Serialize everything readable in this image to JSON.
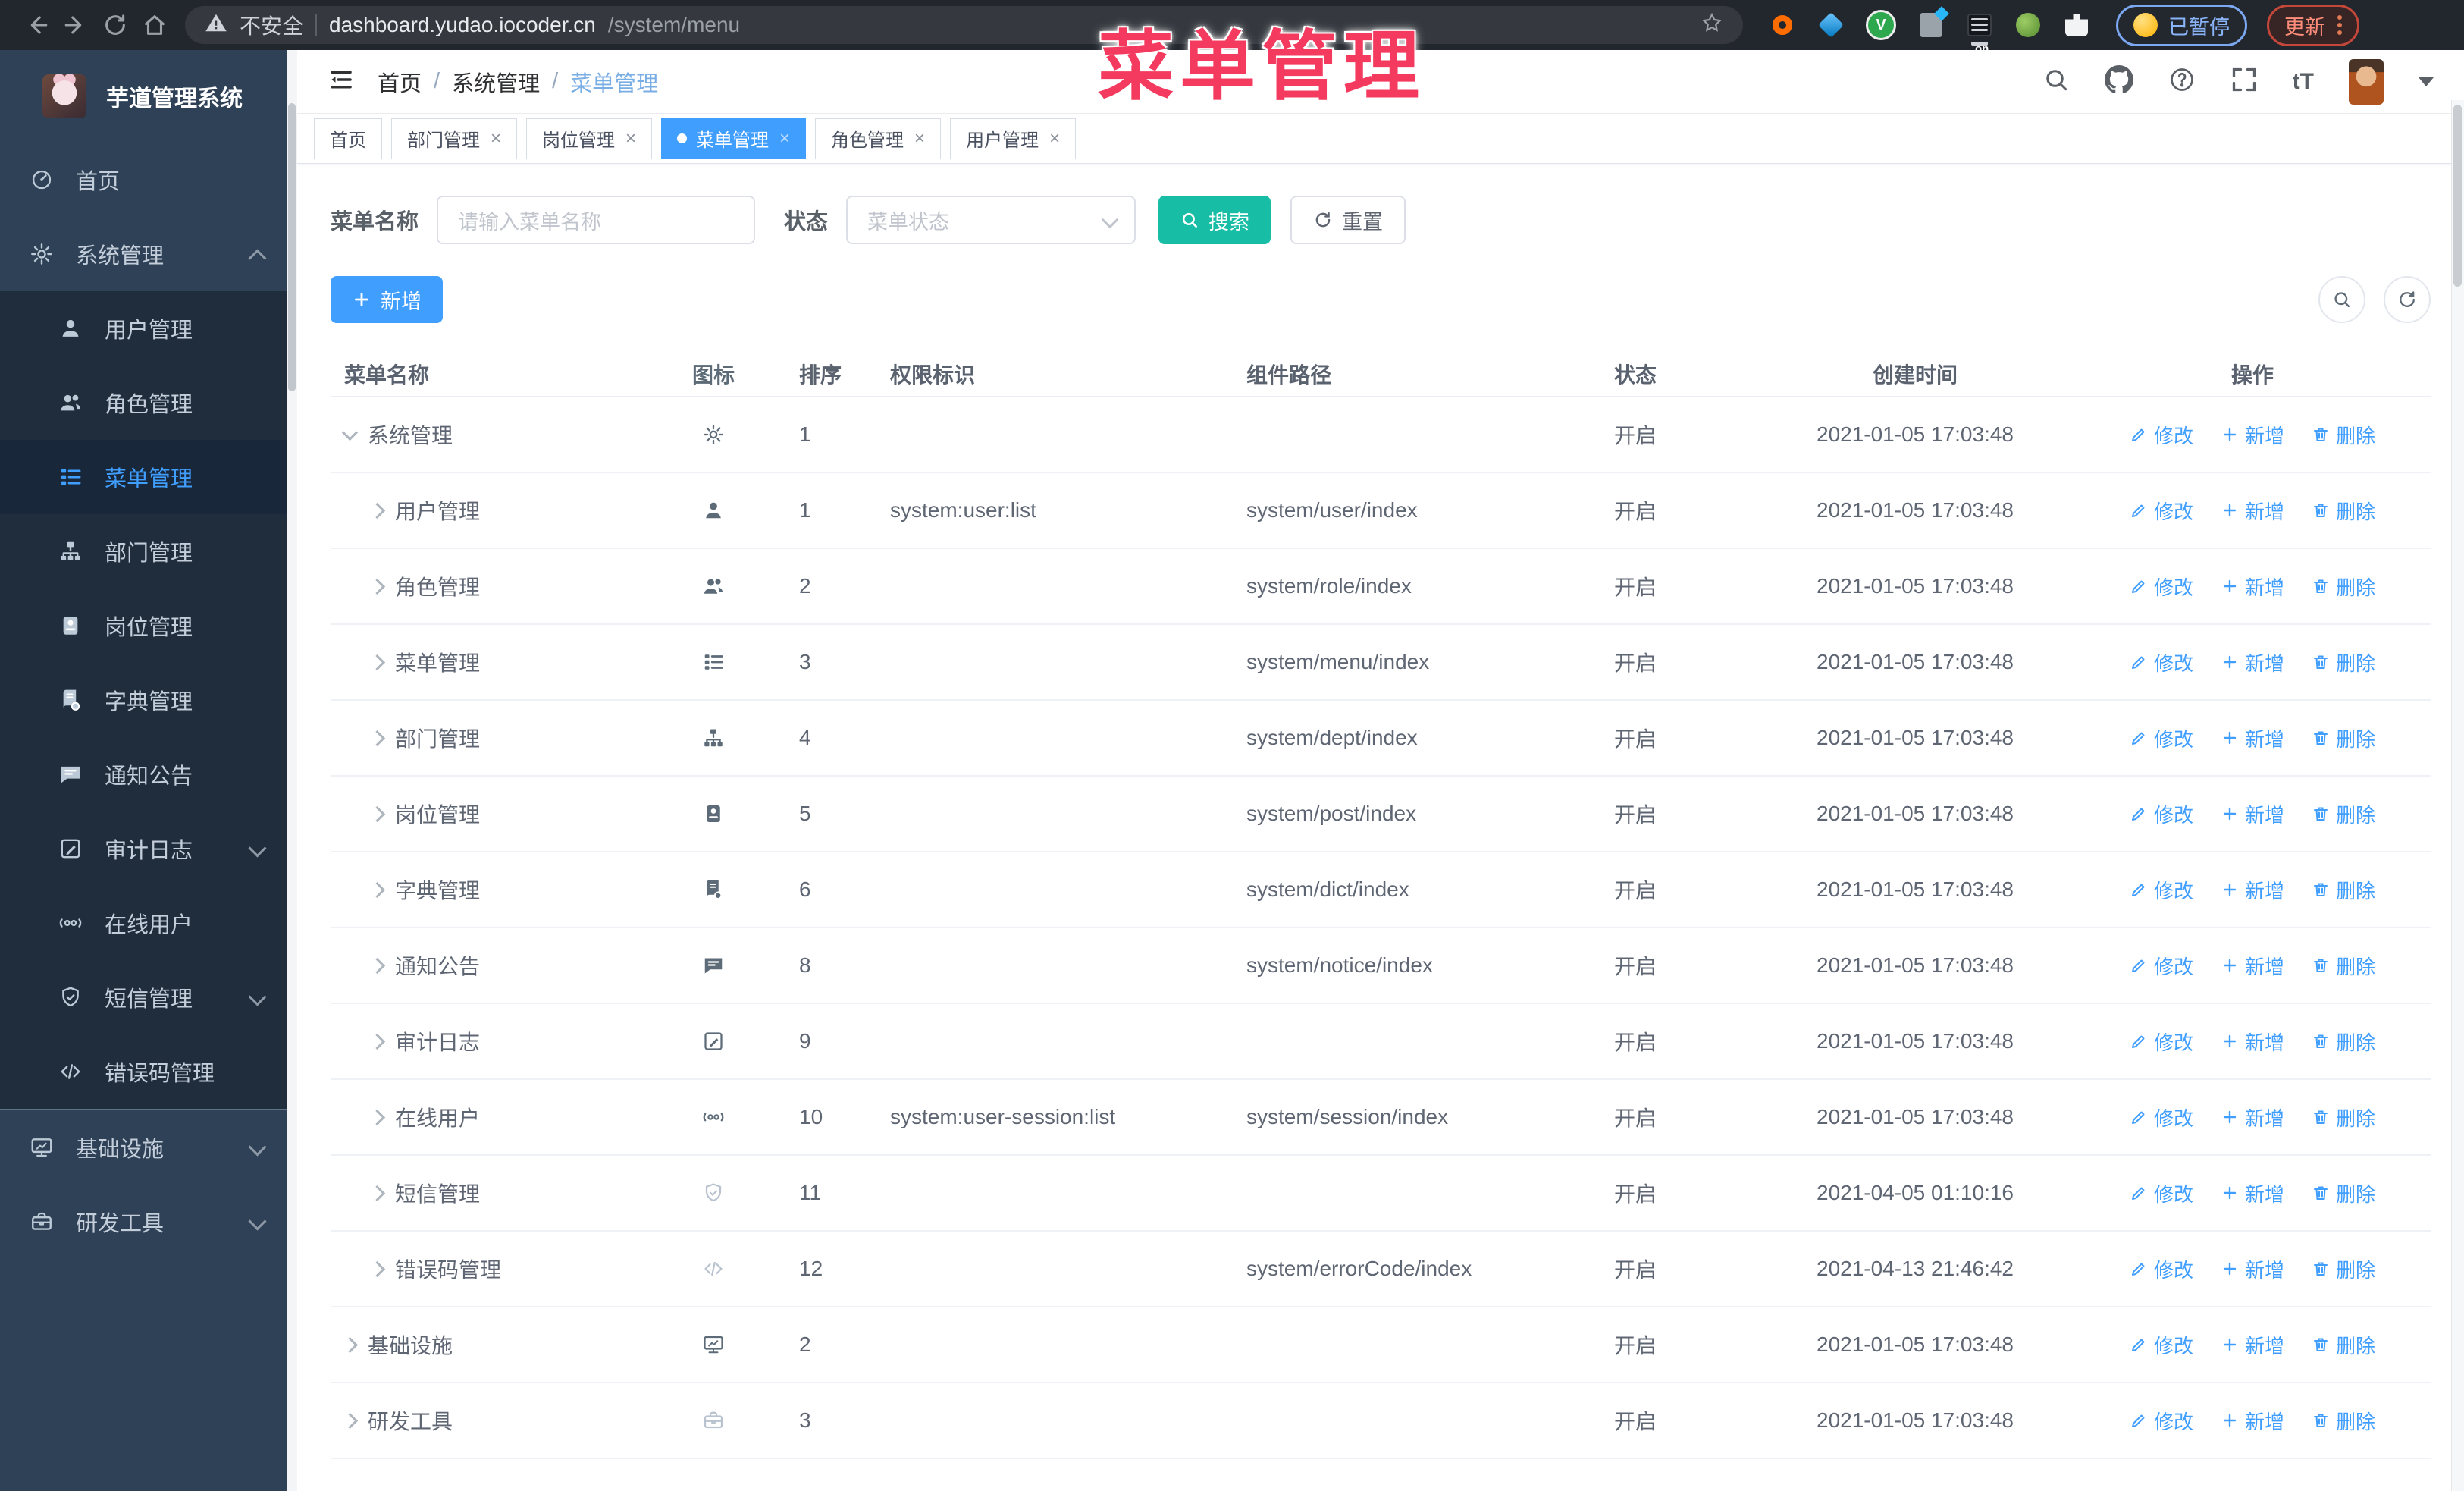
{
  "browser": {
    "security_label": "不安全",
    "url_domain": "dashboard.yudao.iocoder.cn",
    "url_path": "/system/menu",
    "paused_badge": "已暂停",
    "update_button": "更新"
  },
  "watermark": "菜单管理",
  "sidebar": {
    "logo_title": "芋道管理系统",
    "items": [
      {
        "key": "home",
        "label": "首页",
        "icon": "home",
        "type": "top"
      },
      {
        "key": "system-management",
        "label": "系统管理",
        "icon": "gear",
        "type": "top",
        "arrow": "up"
      },
      {
        "key": "user-management",
        "label": "用户管理",
        "icon": "user",
        "type": "sub"
      },
      {
        "key": "role-management",
        "label": "角色管理",
        "icon": "users",
        "type": "sub"
      },
      {
        "key": "menu-management",
        "label": "菜单管理",
        "icon": "menu",
        "type": "sub",
        "active": true
      },
      {
        "key": "dept-management",
        "label": "部门管理",
        "icon": "tree",
        "type": "sub"
      },
      {
        "key": "post-management",
        "label": "岗位管理",
        "icon": "badge",
        "type": "sub"
      },
      {
        "key": "dict-management",
        "label": "字典管理",
        "icon": "dict",
        "type": "sub"
      },
      {
        "key": "notice",
        "label": "通知公告",
        "icon": "message",
        "type": "sub"
      },
      {
        "key": "audit-log",
        "label": "审计日志",
        "icon": "log",
        "type": "sub",
        "arrow": "down"
      },
      {
        "key": "online-users",
        "label": "在线用户",
        "icon": "online",
        "type": "sub"
      },
      {
        "key": "sms-management",
        "label": "短信管理",
        "icon": "shield",
        "type": "sub",
        "arrow": "down"
      },
      {
        "key": "error-code-management",
        "label": "错误码管理",
        "icon": "code",
        "type": "sub"
      },
      {
        "key": "infrastructure",
        "label": "基础设施",
        "icon": "monitor",
        "type": "top",
        "arrow": "down"
      },
      {
        "key": "dev-tools",
        "label": "研发工具",
        "icon": "tool",
        "type": "top",
        "arrow": "down"
      }
    ]
  },
  "header": {
    "breadcrumb": [
      "首页",
      "系统管理",
      "菜单管理"
    ]
  },
  "tabs": [
    {
      "key": "home",
      "label": "首页",
      "closable": false,
      "active": false
    },
    {
      "key": "dept-management",
      "label": "部门管理",
      "closable": true,
      "active": false
    },
    {
      "key": "post-management",
      "label": "岗位管理",
      "closable": true,
      "active": false
    },
    {
      "key": "menu-management",
      "label": "菜单管理",
      "closable": true,
      "active": true
    },
    {
      "key": "role-management",
      "label": "角色管理",
      "closable": true,
      "active": false
    },
    {
      "key": "user-management",
      "label": "用户管理",
      "closable": true,
      "active": false
    }
  ],
  "filter": {
    "name_label": "菜单名称",
    "name_placeholder": "请输入菜单名称",
    "status_label": "状态",
    "status_placeholder": "菜单状态",
    "search_label": "搜索",
    "reset_label": "重置",
    "add_label": "新增"
  },
  "table": {
    "columns": [
      "菜单名称",
      "图标",
      "排序",
      "权限标识",
      "组件路径",
      "状态",
      "创建时间",
      "操作"
    ],
    "action_labels": {
      "edit": "修改",
      "add": "新增",
      "delete": "删除"
    },
    "rows": [
      {
        "key": "system-management",
        "name": "系统管理",
        "level": 0,
        "expanded": true,
        "icon": "gear",
        "sort": "1",
        "perm": "",
        "path": "",
        "status": "开启",
        "time": "2021-01-05 17:03:48"
      },
      {
        "key": "user-management",
        "name": "用户管理",
        "level": 1,
        "icon": "user",
        "sort": "1",
        "perm": "system:user:list",
        "path": "system/user/index",
        "status": "开启",
        "time": "2021-01-05 17:03:48"
      },
      {
        "key": "role-management",
        "name": "角色管理",
        "level": 1,
        "icon": "users",
        "sort": "2",
        "perm": "",
        "path": "system/role/index",
        "status": "开启",
        "time": "2021-01-05 17:03:48"
      },
      {
        "key": "menu-management",
        "name": "菜单管理",
        "level": 1,
        "icon": "menu",
        "sort": "3",
        "perm": "",
        "path": "system/menu/index",
        "status": "开启",
        "time": "2021-01-05 17:03:48"
      },
      {
        "key": "dept-management",
        "name": "部门管理",
        "level": 1,
        "icon": "tree",
        "sort": "4",
        "perm": "",
        "path": "system/dept/index",
        "status": "开启",
        "time": "2021-01-05 17:03:48"
      },
      {
        "key": "post-management",
        "name": "岗位管理",
        "level": 1,
        "icon": "badge",
        "sort": "5",
        "perm": "",
        "path": "system/post/index",
        "status": "开启",
        "time": "2021-01-05 17:03:48"
      },
      {
        "key": "dict-management",
        "name": "字典管理",
        "level": 1,
        "icon": "dict",
        "sort": "6",
        "perm": "",
        "path": "system/dict/index",
        "status": "开启",
        "time": "2021-01-05 17:03:48"
      },
      {
        "key": "notice",
        "name": "通知公告",
        "level": 1,
        "icon": "message",
        "sort": "8",
        "perm": "",
        "path": "system/notice/index",
        "status": "开启",
        "time": "2021-01-05 17:03:48"
      },
      {
        "key": "audit-log",
        "name": "审计日志",
        "level": 1,
        "icon": "log",
        "sort": "9",
        "perm": "",
        "path": "",
        "status": "开启",
        "time": "2021-01-05 17:03:48"
      },
      {
        "key": "online-users",
        "name": "在线用户",
        "level": 1,
        "icon": "online",
        "sort": "10",
        "perm": "system:user-session:list",
        "path": "system/session/index",
        "status": "开启",
        "time": "2021-01-05 17:03:48"
      },
      {
        "key": "sms-management",
        "name": "短信管理",
        "level": 1,
        "icon": "shield",
        "icon_light": true,
        "sort": "11",
        "perm": "",
        "path": "",
        "status": "开启",
        "time": "2021-04-05 01:10:16"
      },
      {
        "key": "error-code-management",
        "name": "错误码管理",
        "level": 1,
        "icon": "code",
        "icon_light": true,
        "sort": "12",
        "perm": "",
        "path": "system/errorCode/index",
        "status": "开启",
        "time": "2021-04-13 21:46:42"
      },
      {
        "key": "infrastructure",
        "name": "基础设施",
        "level": 0,
        "expanded": false,
        "icon": "monitor",
        "sort": "2",
        "perm": "",
        "path": "",
        "status": "开启",
        "time": "2021-01-05 17:03:48"
      },
      {
        "key": "dev-tools",
        "name": "研发工具",
        "level": 0,
        "expanded": false,
        "icon": "tool",
        "icon_light": true,
        "sort": "3",
        "perm": "",
        "path": "",
        "status": "开启",
        "time": "2021-01-05 17:03:48"
      }
    ]
  },
  "colors": {
    "primary": "#409eff",
    "search_button": "#17bda5",
    "sidebar_bg": "#2f4156",
    "sidebar_sub_bg": "#1f2d3d",
    "watermark": "#f43b5f"
  }
}
